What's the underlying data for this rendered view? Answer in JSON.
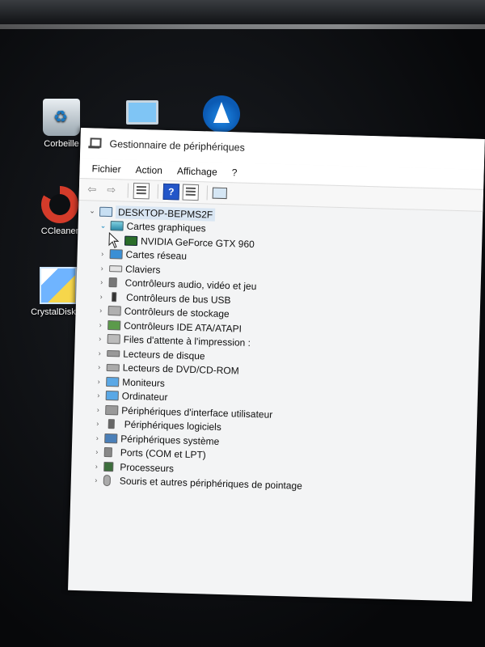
{
  "desktop": {
    "icons": [
      {
        "label": "Corbeille",
        "icon": "recycle-bin-icon"
      },
      {
        "label": "",
        "icon": "this-pc-icon"
      },
      {
        "label": "",
        "icon": "vlc-icon"
      },
      {
        "label": "CCleaner",
        "icon": "ccleaner-icon"
      },
      {
        "label": "CrystalDiskInf",
        "icon": "crystaldiskinfo-icon"
      }
    ]
  },
  "window": {
    "title": "Gestionnaire de périphériques",
    "menu": [
      "Fichier",
      "Action",
      "Affichage",
      "?"
    ]
  },
  "tree": {
    "root": "DESKTOP-BEPMS2F",
    "categories": [
      {
        "label": "Cartes graphiques",
        "expanded": true,
        "children": [
          "NVIDIA GeForce GTX 960"
        ]
      },
      {
        "label": "Cartes réseau"
      },
      {
        "label": "Claviers"
      },
      {
        "label": "Contrôleurs audio, vidéo et jeu"
      },
      {
        "label": "Contrôleurs de bus USB"
      },
      {
        "label": "Contrôleurs de stockage"
      },
      {
        "label": "Contrôleurs IDE ATA/ATAPI"
      },
      {
        "label": "Files d'attente à l'impression :"
      },
      {
        "label": "Lecteurs de disque"
      },
      {
        "label": "Lecteurs de DVD/CD-ROM"
      },
      {
        "label": "Moniteurs"
      },
      {
        "label": "Ordinateur"
      },
      {
        "label": "Périphériques d'interface utilisateur"
      },
      {
        "label": "Périphériques logiciels"
      },
      {
        "label": "Périphériques système"
      },
      {
        "label": "Ports (COM et LPT)"
      },
      {
        "label": "Processeurs"
      },
      {
        "label": "Souris et autres périphériques de pointage"
      }
    ]
  }
}
